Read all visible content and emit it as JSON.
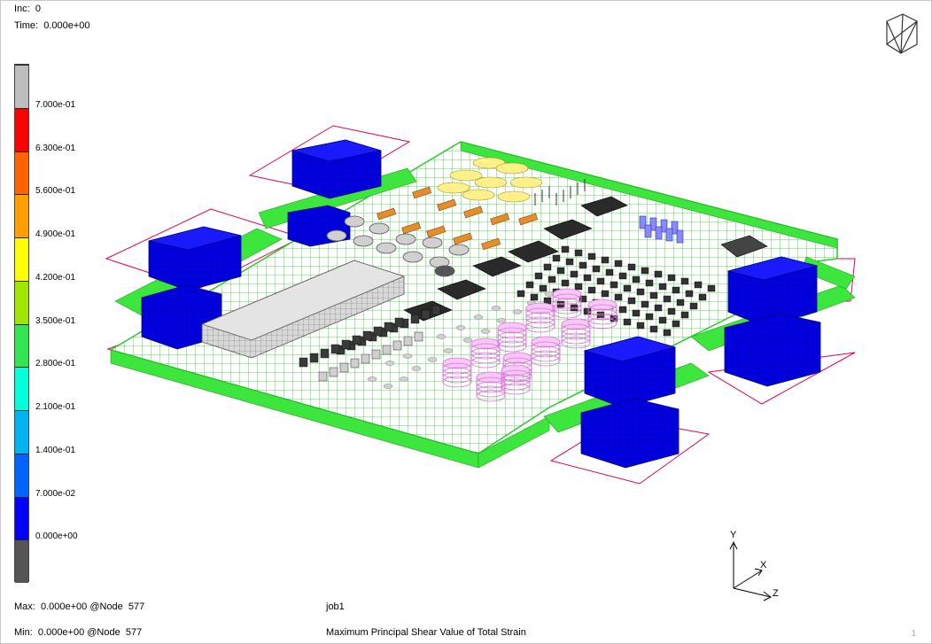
{
  "header": {
    "inc_label": "Inc:",
    "inc_value": "0",
    "time_label": "Time:",
    "time_value": "0.000e+00"
  },
  "legend": {
    "colors": [
      "#bdbdbd",
      "#ff0000",
      "#ff6400",
      "#ffa000",
      "#ffff00",
      "#a0e600",
      "#32e650",
      "#00ffdc",
      "#00b4f0",
      "#0064ff",
      "#0000ff",
      "#555555"
    ],
    "labels": [
      "7.000e-01",
      "6.300e-01",
      "5.600e-01",
      "4.900e-01",
      "4.200e-01",
      "3.500e-01",
      "2.800e-01",
      "2.100e-01",
      "1.400e-01",
      "7.000e-02",
      "0.000e+00"
    ]
  },
  "footer": {
    "max_label": "Max:",
    "max_value": "0.000e+00 @Node  577",
    "min_label": "Min:",
    "min_value": "0.000e+00 @Node  577",
    "job": "job1",
    "result_name": "Maximum Principal Shear Value of Total Strain",
    "page": "1"
  },
  "axes": {
    "x_label": "X",
    "y_label": "Y",
    "z_label": "Z"
  },
  "colors": {
    "board_green": "#3ce63c",
    "block_blue": "#0000e0",
    "outline_red": "#e0005a",
    "component_gray": "#c8c8c8",
    "ic_black": "#222222",
    "resistor_orange": "#e68c2a",
    "cap_pink": "#f0a0f0",
    "cap_yellow": "#ffee88",
    "cap_blue": "#8a8aff"
  }
}
